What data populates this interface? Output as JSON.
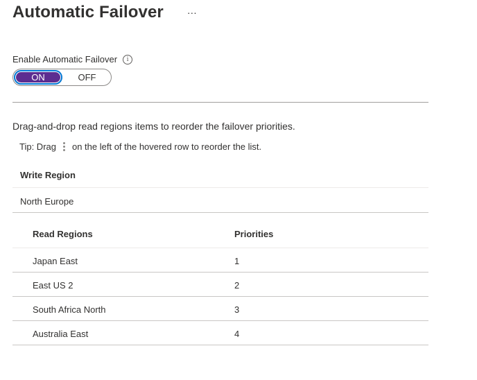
{
  "page": {
    "title": "Automatic Failover",
    "more_label": "···"
  },
  "failover_toggle": {
    "label": "Enable Automatic Failover",
    "info_icon": "info-icon",
    "on_label": "ON",
    "off_label": "OFF",
    "selected": "ON",
    "accent_color": "#5c2d91"
  },
  "description": "Drag-and-drop read regions items to reorder the failover priorities.",
  "tip": {
    "prefix": "Tip: Drag",
    "icon": "drag-handle-icon",
    "suffix": "on the left of the hovered row to reorder the list."
  },
  "write_region": {
    "header": "Write Region",
    "value": "North Europe"
  },
  "read_regions": {
    "headers": [
      "Read Regions",
      "Priorities"
    ],
    "rows": [
      {
        "region": "Japan East",
        "priority": "1"
      },
      {
        "region": "East US 2",
        "priority": "2"
      },
      {
        "region": "South Africa North",
        "priority": "3"
      },
      {
        "region": "Australia East",
        "priority": "4"
      }
    ]
  }
}
